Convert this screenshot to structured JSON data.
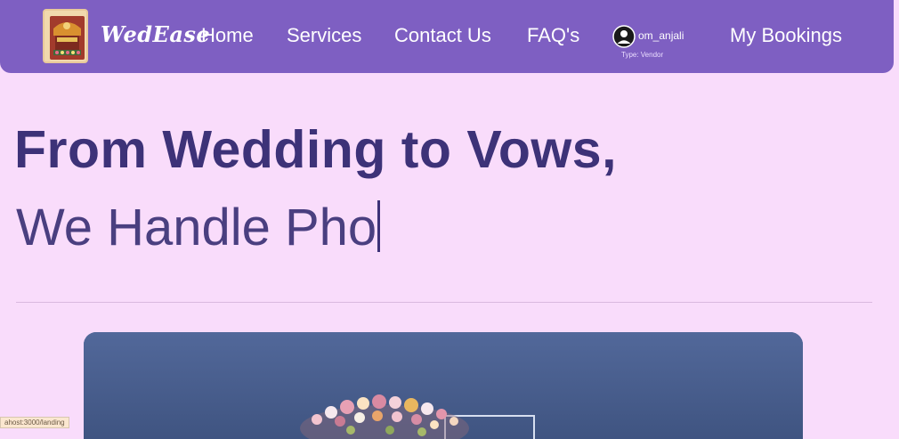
{
  "navbar": {
    "brand": "WedEase",
    "links": [
      "Home",
      "Services",
      "Contact Us",
      "FAQ's"
    ],
    "user": {
      "name": "om_anjali",
      "type": "Type: Vendor"
    },
    "my_bookings": "My Bookings"
  },
  "hero": {
    "heading": "From Wedding to Vows,",
    "typed_text": "We Handle Pho"
  },
  "status_bar": {
    "url": "ahost:3000/landing"
  },
  "colors": {
    "navbar": "#7e5fc2",
    "page_background": "#f9dcfb",
    "heading": "#3d3278",
    "hero_image": "#4e6392"
  }
}
